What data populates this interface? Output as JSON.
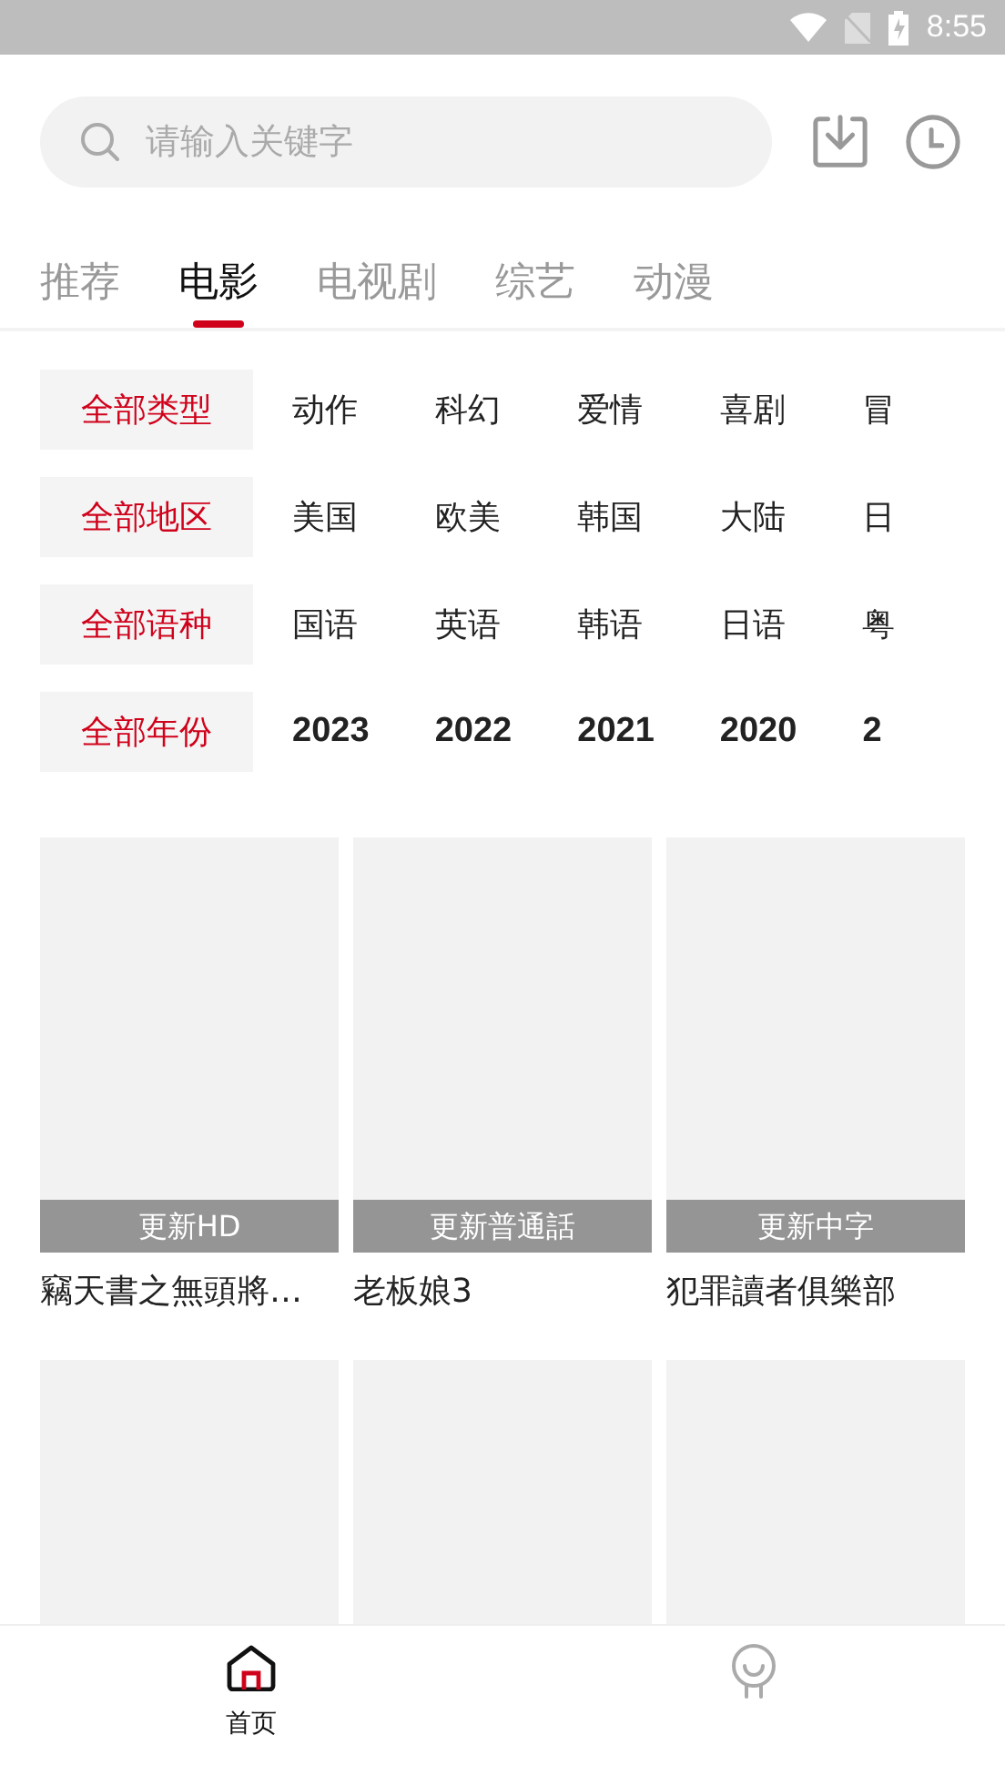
{
  "status_bar": {
    "time": "8:55"
  },
  "search": {
    "placeholder": "请输入关键字"
  },
  "tabs": [
    {
      "label": "推荐",
      "selected": false
    },
    {
      "label": "电影",
      "selected": true
    },
    {
      "label": "电视剧",
      "selected": false
    },
    {
      "label": "综艺",
      "selected": false
    },
    {
      "label": "动漫",
      "selected": false
    }
  ],
  "filters": [
    {
      "options": [
        {
          "label": "全部类型",
          "selected": true
        },
        {
          "label": "动作",
          "selected": false
        },
        {
          "label": "科幻",
          "selected": false
        },
        {
          "label": "爱情",
          "selected": false
        },
        {
          "label": "喜剧",
          "selected": false
        },
        {
          "label": "冒",
          "selected": false
        }
      ]
    },
    {
      "options": [
        {
          "label": "全部地区",
          "selected": true
        },
        {
          "label": "美国",
          "selected": false
        },
        {
          "label": "欧美",
          "selected": false
        },
        {
          "label": "韩国",
          "selected": false
        },
        {
          "label": "大陆",
          "selected": false
        },
        {
          "label": "日",
          "selected": false
        }
      ]
    },
    {
      "options": [
        {
          "label": "全部语种",
          "selected": true
        },
        {
          "label": "国语",
          "selected": false
        },
        {
          "label": "英语",
          "selected": false
        },
        {
          "label": "韩语",
          "selected": false
        },
        {
          "label": "日语",
          "selected": false
        },
        {
          "label": "粤",
          "selected": false
        }
      ]
    },
    {
      "options": [
        {
          "label": "全部年份",
          "selected": true
        },
        {
          "label": "2023",
          "selected": false
        },
        {
          "label": "2022",
          "selected": false
        },
        {
          "label": "2021",
          "selected": false
        },
        {
          "label": "2020",
          "selected": false
        },
        {
          "label": "2",
          "selected": false
        }
      ]
    }
  ],
  "movies": [
    {
      "kind": "poster",
      "badge": "更新HD",
      "title": "竊天書之無頭將…"
    },
    {
      "kind": "poster",
      "badge": "更新普通話",
      "title": "老板娘3"
    },
    {
      "kind": "poster",
      "badge": "更新中字",
      "title": "犯罪讀者俱樂部"
    },
    {
      "kind": "poster"
    },
    {
      "kind": "poster"
    },
    {
      "kind": "poster"
    }
  ],
  "bottom_nav": [
    {
      "kind": "home",
      "label": "首页",
      "selected": true
    },
    {
      "kind": "profile",
      "selected": false
    }
  ]
}
